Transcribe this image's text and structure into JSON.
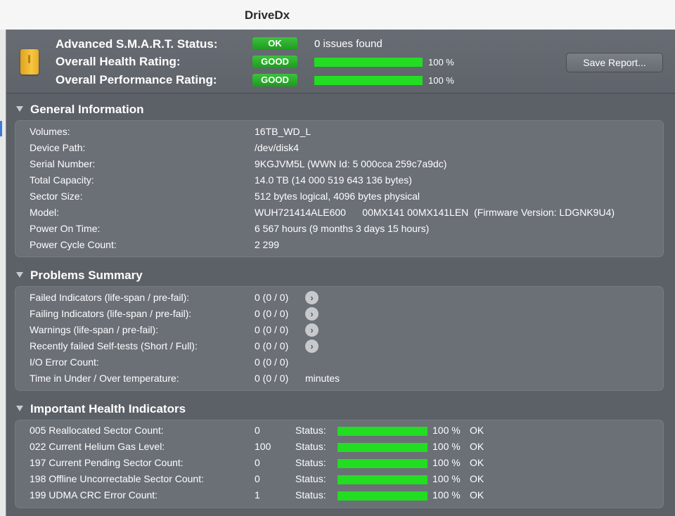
{
  "window": {
    "title": "DriveDx"
  },
  "header": {
    "smart_label": "Advanced S.M.A.R.T. Status:",
    "smart_badge": "OK",
    "smart_issues": "0 issues found",
    "health_label": "Overall Health Rating:",
    "health_badge": "GOOD",
    "health_value": 100,
    "health_pct": "100 %",
    "perf_label": "Overall Performance Rating:",
    "perf_badge": "GOOD",
    "perf_value": 100,
    "perf_pct": "100 %",
    "save_button": "Save Report...",
    "badge_color": "#22bb22",
    "bar_color": "#22dd22"
  },
  "general": {
    "title": "General Information",
    "rows": [
      {
        "label": "Volumes:",
        "value": "16TB_WD_L"
      },
      {
        "label": "Device Path:",
        "value": "/dev/disk4"
      },
      {
        "label": "Serial Number:",
        "value": "9KGJVM5L (WWN Id: 5 000cca 259c7a9dc)"
      },
      {
        "label": "Total Capacity:",
        "value": "14.0 TB (14 000 519 643 136 bytes)"
      },
      {
        "label": "Sector Size:",
        "value": "512 bytes logical, 4096 bytes physical"
      },
      {
        "label": "Model:",
        "value": "WUH721414ALE600      00MX141 00MX141LEN  (Firmware Version: LDGNK9U4)"
      },
      {
        "label": "Power On Time:",
        "value": "6 567 hours (9 months 3 days 15 hours)"
      },
      {
        "label": "Power Cycle Count:",
        "value": "2 299"
      }
    ]
  },
  "problems": {
    "title": "Problems Summary",
    "rows": [
      {
        "label": "Failed Indicators (life-span / pre-fail):",
        "value": "0 (0 / 0)",
        "arrow": true
      },
      {
        "label": "Failing Indicators (life-span / pre-fail):",
        "value": "0 (0 / 0)",
        "arrow": true
      },
      {
        "label": "Warnings (life-span / pre-fail):",
        "value": "0 (0 / 0)",
        "arrow": true
      },
      {
        "label": "Recently failed Self-tests (Short / Full):",
        "value": "0 (0 / 0)",
        "arrow": true
      },
      {
        "label": "I/O Error Count:",
        "value": "0 (0 / 0)",
        "arrow": false
      },
      {
        "label": "Time in Under / Over temperature:",
        "value": "0 (0 / 0)",
        "arrow": false,
        "unit": "minutes"
      }
    ]
  },
  "health": {
    "title": "Important Health Indicators",
    "status_label": "Status:",
    "rows": [
      {
        "label": "005  Reallocated Sector Count:",
        "value": "0",
        "percent": 100,
        "pct_text": "100 %",
        "status": "OK"
      },
      {
        "label": "022  Current Helium Gas Level:",
        "value": "100",
        "percent": 100,
        "pct_text": "100 %",
        "status": "OK"
      },
      {
        "label": "197  Current Pending Sector Count:",
        "value": "0",
        "percent": 100,
        "pct_text": "100 %",
        "status": "OK"
      },
      {
        "label": "198  Offline Uncorrectable Sector Count:",
        "value": "0",
        "percent": 100,
        "pct_text": "100 %",
        "status": "OK"
      },
      {
        "label": "199  UDMA CRC Error Count:",
        "value": "1",
        "percent": 100,
        "pct_text": "100 %",
        "status": "OK"
      }
    ]
  }
}
